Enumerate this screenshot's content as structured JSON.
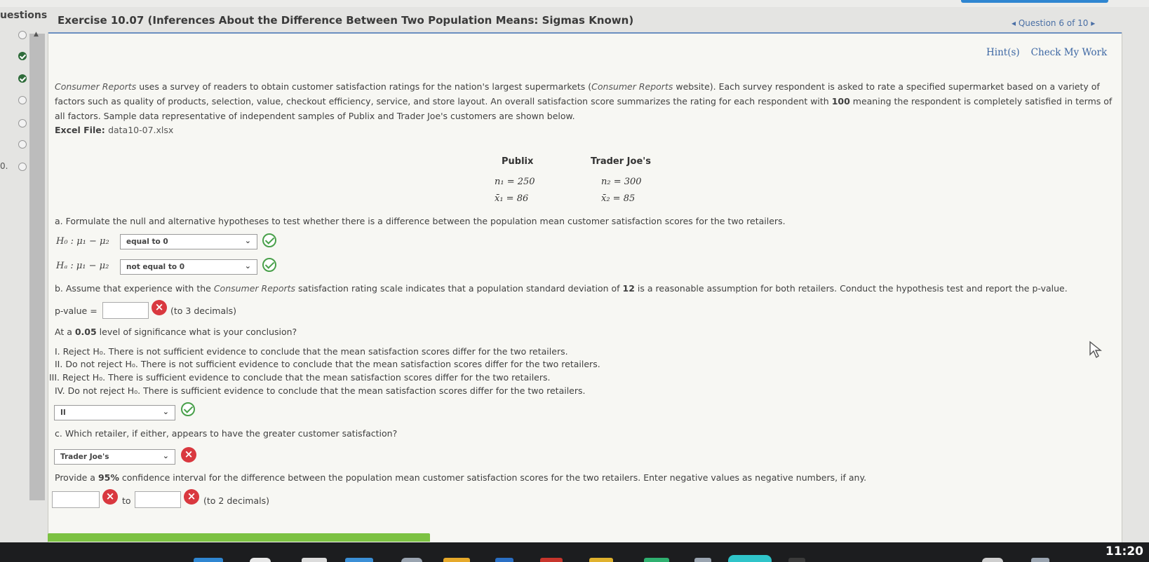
{
  "sidebar": {
    "header": "uestions",
    "visible_number": "0.",
    "question_states": [
      "unanswered",
      "completed",
      "completed",
      "unanswered",
      "unanswered",
      "unanswered",
      "unanswered"
    ]
  },
  "header": {
    "title": "Exercise 10.07 (Inferences About the Difference Between Two Population Means: Sigmas Known)",
    "nav": "◂ Question 6 of 10 ▸"
  },
  "links": {
    "hints": "Hint(s)",
    "check": "Check My Work"
  },
  "intro": {
    "source_italic": "Consumer Reports",
    "text1": " uses a survey of readers to obtain customer satisfaction ratings for the nation's largest supermarkets (",
    "source_italic2": "Consumer Reports",
    "text2": " website). Each survey respondent is asked to rate a specified supermarket based on a variety of factors such as quality of products, selection, value, checkout efficiency, service, and store layout. An overall satisfaction score summarizes the rating for each respondent with ",
    "bold_100": "100",
    "text3": " meaning the respondent is completely satisfied in terms of all factors. Sample data representative of independent samples of Publix and Trader Joe's customers are shown below."
  },
  "excel": {
    "label": "Excel File: ",
    "file": "data10-07.xlsx"
  },
  "table": {
    "col1": "Publix",
    "col2": "Trader Joe's",
    "n1": "n₁ = 250",
    "n2": "n₂ = 300",
    "x1": "x̄₁ = 86",
    "x2": "x̄₂ = 85"
  },
  "part_a": {
    "question": "a. Formulate the null and alternative hypotheses to test whether there is a difference between the population mean customer satisfaction scores for the two retailers.",
    "h0_label": "H₀ : μ₁ − μ₂",
    "h0_value": "equal to 0",
    "ha_label": "Hₐ : μ₁ − μ₂",
    "ha_value": "not equal to 0"
  },
  "part_b": {
    "question_pre": "b. Assume that experience with the ",
    "question_italic": "Consumer Reports",
    "question_mid": " satisfaction rating scale indicates that a population standard deviation of ",
    "question_bold": "12",
    "question_post": " is a reasonable assumption for both retailers. Conduct the hypothesis test and report the p-value.",
    "pvalue_label": "p-value =",
    "pvalue_value": "",
    "pvalue_hint": "(to 3 decimals)",
    "signif_pre": "At a ",
    "signif_bold": "0.05",
    "signif_post": " level of significance what is your conclusion?",
    "options": [
      "I. Reject H₀. There is not sufficient evidence to conclude that the mean satisfaction scores differ for the two retailers.",
      "II. Do not reject H₀. There is not sufficient evidence to conclude that the mean satisfaction scores differ for the two retailers.",
      "III. Reject H₀. There is sufficient evidence to conclude that the mean satisfaction scores differ for the two retailers.",
      "IV. Do not reject H₀. There is sufficient evidence to conclude that the mean satisfaction scores differ for the two retailers."
    ],
    "conclusion_value": "II"
  },
  "part_c": {
    "question": "c. Which retailer, if either, appears to have the greater customer satisfaction?",
    "answer": "Trader Joe's",
    "ci_pre": "Provide a ",
    "ci_bold": "95%",
    "ci_post": " confidence interval for the difference between the population mean customer satisfaction scores for the two retailers. Enter negative values as negative numbers, if any.",
    "ci_low": "",
    "ci_to": "to",
    "ci_high": "",
    "ci_hint": "(to 2 decimals)"
  },
  "taskbar": {
    "clock": "11:20"
  },
  "colors": {
    "link": "#3d67a3",
    "correct": "#49a04a",
    "incorrect": "#d9383f",
    "progress": "#7cc242"
  }
}
